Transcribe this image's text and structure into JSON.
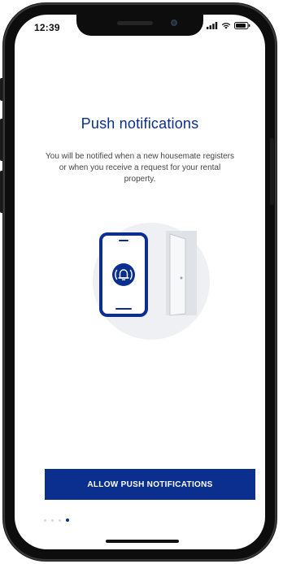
{
  "status_bar": {
    "time": "12:39",
    "icons": [
      "signal-icon",
      "wifi-icon",
      "battery-icon"
    ]
  },
  "onboarding": {
    "title": "Push notifications",
    "description": "You will be notified when a new housemate registers or when you receive a request for your rental property.",
    "cta_label": "ALLOW PUSH NOTIFICATIONS",
    "illustration": "phone-notification-door-illustration",
    "pager": {
      "total": 4,
      "active_index": 3
    }
  },
  "colors": {
    "brand": "#0b2f8e",
    "title": "#0a2f8a",
    "text": "#444444",
    "illustration_bg": "#eff0f3",
    "door": "#d8dbe1"
  }
}
